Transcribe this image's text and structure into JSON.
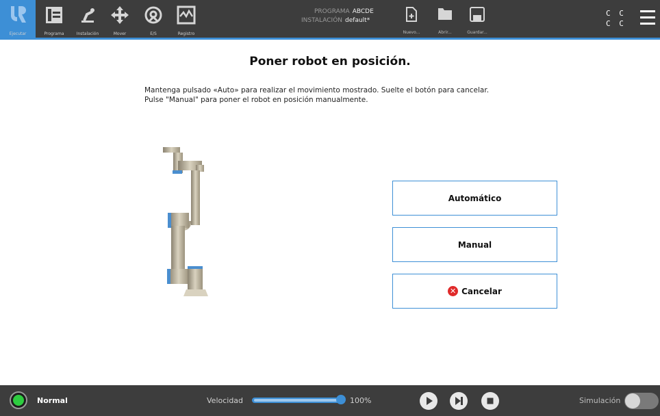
{
  "header": {
    "tabs": [
      {
        "label": "Ejecutar",
        "icon": "ur-logo-icon",
        "active": true
      },
      {
        "label": "Programa",
        "icon": "program-icon",
        "active": false
      },
      {
        "label": "Instalación",
        "icon": "installation-icon",
        "active": false
      },
      {
        "label": "Mover",
        "icon": "move-icon",
        "active": false
      },
      {
        "label": "E/S",
        "icon": "io-icon",
        "active": false
      },
      {
        "label": "Registro",
        "icon": "log-icon",
        "active": false
      }
    ],
    "program_label": "PROGRAMA",
    "program_value": "ABCDE",
    "installation_label": "INSTALACIÓN",
    "installation_value": "default*",
    "file_buttons": [
      {
        "label": "Nuevo...",
        "icon": "new-file-icon"
      },
      {
        "label": "Abrir...",
        "icon": "open-folder-icon"
      },
      {
        "label": "Guardar...",
        "icon": "save-icon"
      }
    ],
    "cc_indicator": [
      "C C",
      "C C"
    ],
    "accent_color": "#3d8fd6"
  },
  "main": {
    "title": "Poner robot en posición.",
    "instruction_line1": "Mantenga pulsado «Auto» para realizar el movimiento mostrado. Suelte el botón para cancelar.",
    "instruction_line2": "Pulse \"Manual\" para poner el robot en posición manualmente.",
    "buttons": {
      "auto": "Automático",
      "manual": "Manual",
      "cancel": "Cancelar"
    }
  },
  "footer": {
    "status": "Normal",
    "status_color": "#2ecc40",
    "speed_label": "Velocidad",
    "speed_percent": 100,
    "speed_value": "100%",
    "simulation_label": "Simulación",
    "simulation_on": false
  }
}
